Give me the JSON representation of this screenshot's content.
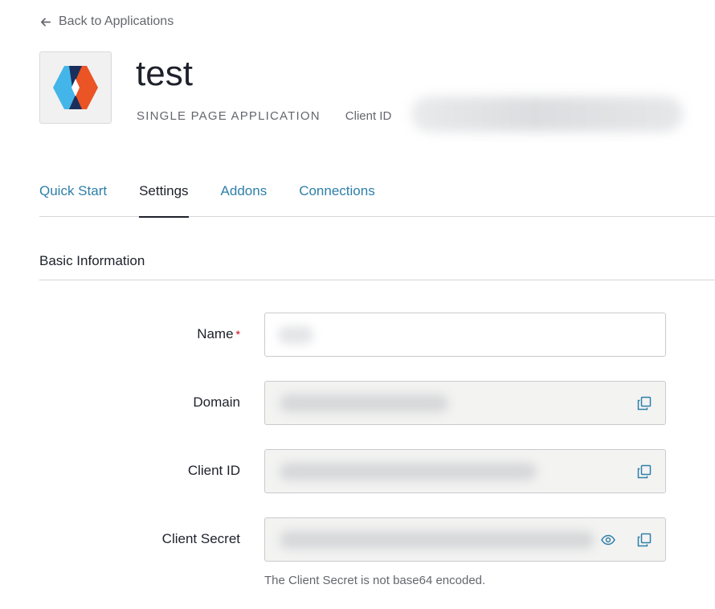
{
  "nav": {
    "back_label": "Back to Applications"
  },
  "app": {
    "name": "test",
    "type": "SINGLE PAGE APPLICATION",
    "client_id_label": "Client ID"
  },
  "tabs": [
    {
      "label": "Quick Start",
      "active": false
    },
    {
      "label": "Settings",
      "active": true
    },
    {
      "label": "Addons",
      "active": false
    },
    {
      "label": "Connections",
      "active": false
    }
  ],
  "section": {
    "title": "Basic Information"
  },
  "form": {
    "name_label": "Name",
    "required_mark": "*",
    "domain_label": "Domain",
    "client_id_label": "Client ID",
    "client_secret_label": "Client Secret",
    "client_secret_hint": "The Client Secret is not base64 encoded."
  },
  "icons": {
    "back": "arrow-left-icon",
    "copy": "copy-icon",
    "reveal": "eye-icon"
  },
  "colors": {
    "link": "#2e7fa8",
    "text": "#1e212a",
    "muted": "#65676e",
    "required": "#d0021b",
    "logo_blue": "#44b5e8",
    "logo_orange": "#eb5424",
    "logo_navy": "#1a2f5c"
  }
}
